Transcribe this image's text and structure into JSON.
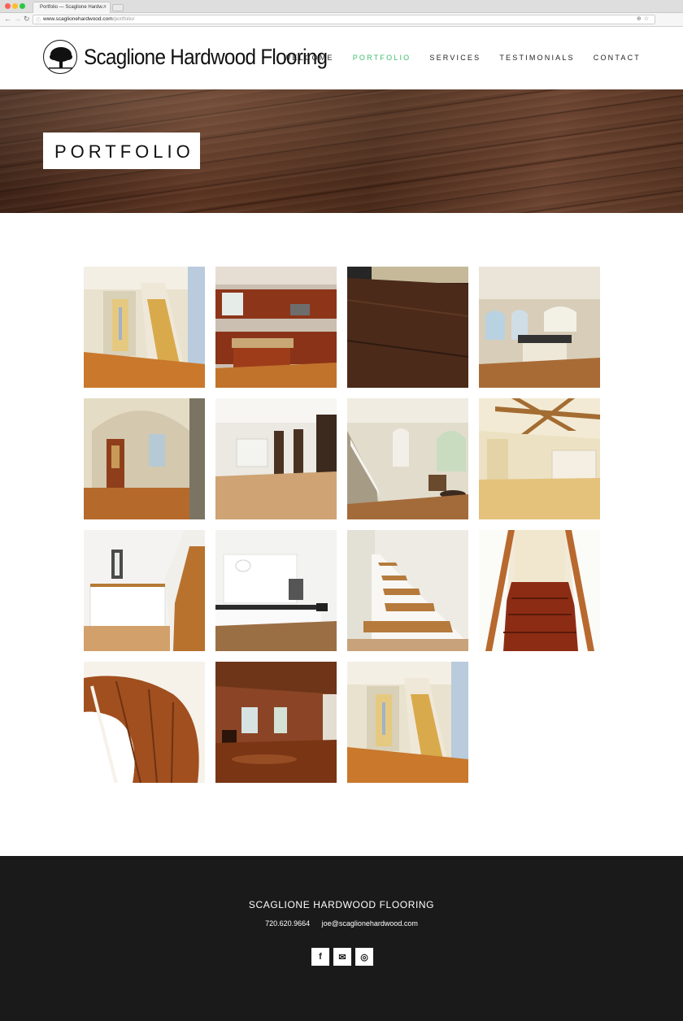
{
  "browser": {
    "tab_title": "Portfolio — Scaglione Hardw...",
    "tab_close": "×",
    "url_host": "www.scaglionehardwood.com",
    "url_path": "/portfolio/"
  },
  "header": {
    "logo_text": "Scaglione Hardwood Flooring",
    "nav": [
      "WELCOME",
      "PORTFOLIO",
      "SERVICES",
      "TESTIMONIALS",
      "CONTACT"
    ],
    "active_nav": "PORTFOLIO",
    "accent_color": "#3dbd6b"
  },
  "banner": {
    "title": "PORTFOLIO"
  },
  "gallery": {
    "photos": [
      {
        "subject": "hallway-staircase"
      },
      {
        "subject": "kitchen-cherry-cabinets"
      },
      {
        "subject": "dark-hardwood-floor"
      },
      {
        "subject": "open-kitchen-arches"
      },
      {
        "subject": "entry-arch-door"
      },
      {
        "subject": "empty-room-white"
      },
      {
        "subject": "foyer-stairs-lounge"
      },
      {
        "subject": "beamed-ceiling-room"
      },
      {
        "subject": "white-stair-railing"
      },
      {
        "subject": "modern-white-kitchen"
      },
      {
        "subject": "floating-stairs"
      },
      {
        "subject": "red-stairs-white-rails"
      },
      {
        "subject": "spiral-stairs"
      },
      {
        "subject": "wood-panel-room"
      },
      {
        "subject": "hallway-staircase-repeat"
      }
    ]
  },
  "footer": {
    "title": "SCAGLIONE HARDWOOD FLOORING",
    "phone": "720.620.9664",
    "email": "joe@scaglionehardwood.com",
    "socials": [
      "facebook-icon",
      "email-icon",
      "instagram-icon"
    ],
    "social_glyphs": [
      "f",
      "✉",
      "◎"
    ]
  }
}
